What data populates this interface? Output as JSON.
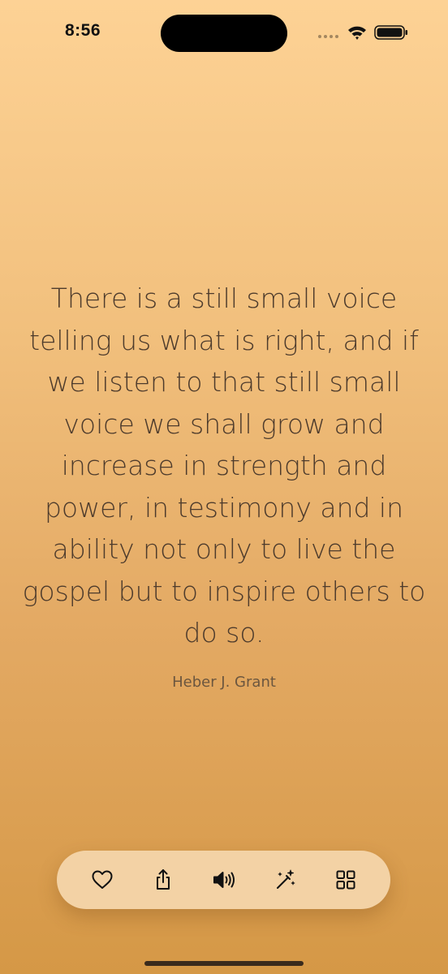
{
  "status_bar": {
    "time": "8:56"
  },
  "quote": {
    "text": "There is a still small voice telling us what is right, and if we listen to that still small voice we shall grow and increase in strength and power, in testimony and in ability not only to live the gospel but to inspire others to do so.",
    "author": "Heber J. Grant"
  },
  "toolbar": {
    "buttons": [
      {
        "icon": "heart-icon"
      },
      {
        "icon": "share-icon"
      },
      {
        "icon": "speaker-icon"
      },
      {
        "icon": "magic-wand-icon"
      },
      {
        "icon": "grid-icon"
      }
    ]
  },
  "colors": {
    "background_top": "#fdd295",
    "background_bottom": "#d59846",
    "toolbar_bg": "#f3d2a5",
    "text": "#4d3b2c"
  }
}
